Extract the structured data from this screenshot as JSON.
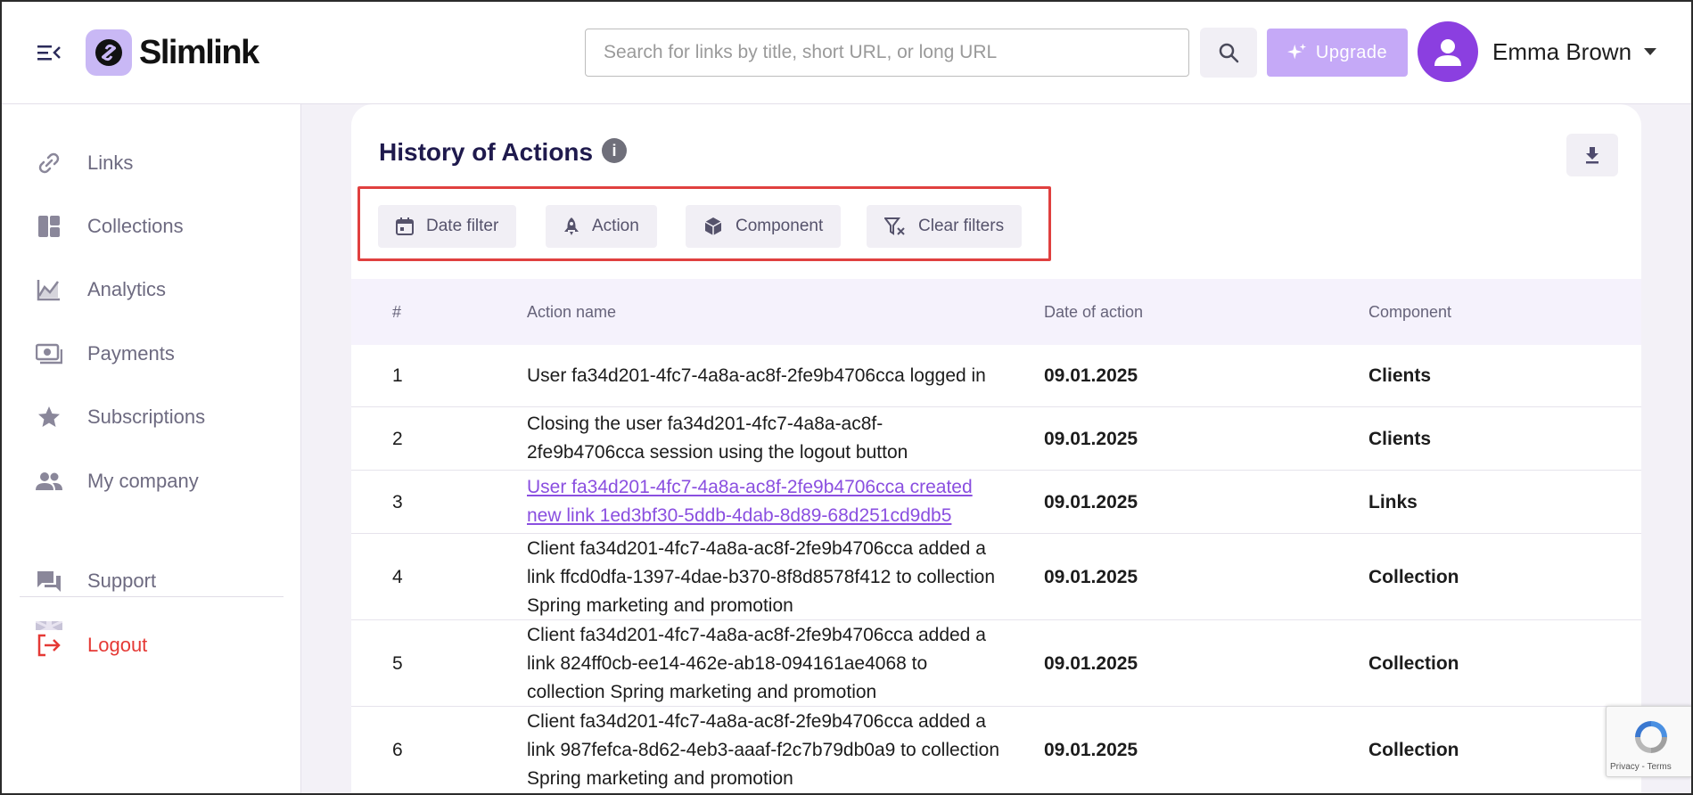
{
  "app": {
    "name": "Slimlink"
  },
  "header": {
    "search_placeholder": "Search for links by title, short URL, or long URL",
    "upgrade_label": "Upgrade",
    "user_name": "Emma Brown"
  },
  "sidebar": {
    "items": [
      {
        "label": "Links",
        "icon": "link-icon"
      },
      {
        "label": "Collections",
        "icon": "collections-icon"
      },
      {
        "label": "Analytics",
        "icon": "analytics-icon"
      },
      {
        "label": "Payments",
        "icon": "payments-icon"
      },
      {
        "label": "Subscriptions",
        "icon": "star-icon"
      },
      {
        "label": "My company",
        "icon": "people-icon"
      },
      {
        "label": "Support",
        "icon": "support-icon"
      },
      {
        "label": "Logout",
        "icon": "logout-icon"
      }
    ]
  },
  "main": {
    "title": "History of Actions",
    "info_symbol": "i",
    "filters": [
      {
        "label": "Date filter",
        "icon": "calendar-icon"
      },
      {
        "label": "Action",
        "icon": "rocket-icon"
      },
      {
        "label": "Component",
        "icon": "cube-icon"
      },
      {
        "label": "Clear filters",
        "icon": "filter-clear-icon"
      }
    ],
    "table": {
      "headers": [
        "#",
        "Action name",
        "Date of action",
        "Component"
      ],
      "rows": [
        {
          "num": "1",
          "name": "User fa34d201-4fc7-4a8a-ac8f-2fe9b4706cca logged in",
          "date": "09.01.2025",
          "component": "Clients",
          "is_link": false
        },
        {
          "num": "2",
          "name": "Closing the user fa34d201-4fc7-4a8a-ac8f-2fe9b4706cca session using the logout button",
          "date": "09.01.2025",
          "component": "Clients",
          "is_link": false
        },
        {
          "num": "3",
          "name": "User fa34d201-4fc7-4a8a-ac8f-2fe9b4706cca created new link 1ed3bf30-5ddb-4dab-8d89-68d251cd9db5",
          "date": "09.01.2025",
          "component": "Links",
          "is_link": true
        },
        {
          "num": "4",
          "name": "Client fa34d201-4fc7-4a8a-ac8f-2fe9b4706cca added a link ffcd0dfa-1397-4dae-b370-8f8d8578f412 to collection Spring marketing and promotion",
          "date": "09.01.2025",
          "component": "Collection",
          "is_link": false
        },
        {
          "num": "5",
          "name": "Client fa34d201-4fc7-4a8a-ac8f-2fe9b4706cca added a link 824ff0cb-ee14-462e-ab18-094161ae4068 to collection Spring marketing and promotion",
          "date": "09.01.2025",
          "component": "Collection",
          "is_link": false
        },
        {
          "num": "6",
          "name": "Client fa34d201-4fc7-4a8a-ac8f-2fe9b4706cca added a link 987fefca-8d62-4eb3-aaaf-f2c7b79db0a9 to collection Spring marketing and promotion",
          "date": "09.01.2025",
          "component": "Collection",
          "is_link": false
        }
      ]
    }
  },
  "recaptcha": {
    "text": "Privacy - Terms"
  },
  "colors": {
    "accent": "#8b3fe0",
    "upgrade": "#c5a9f7",
    "logout": "#e53935",
    "highlight_box": "#e0403f"
  }
}
